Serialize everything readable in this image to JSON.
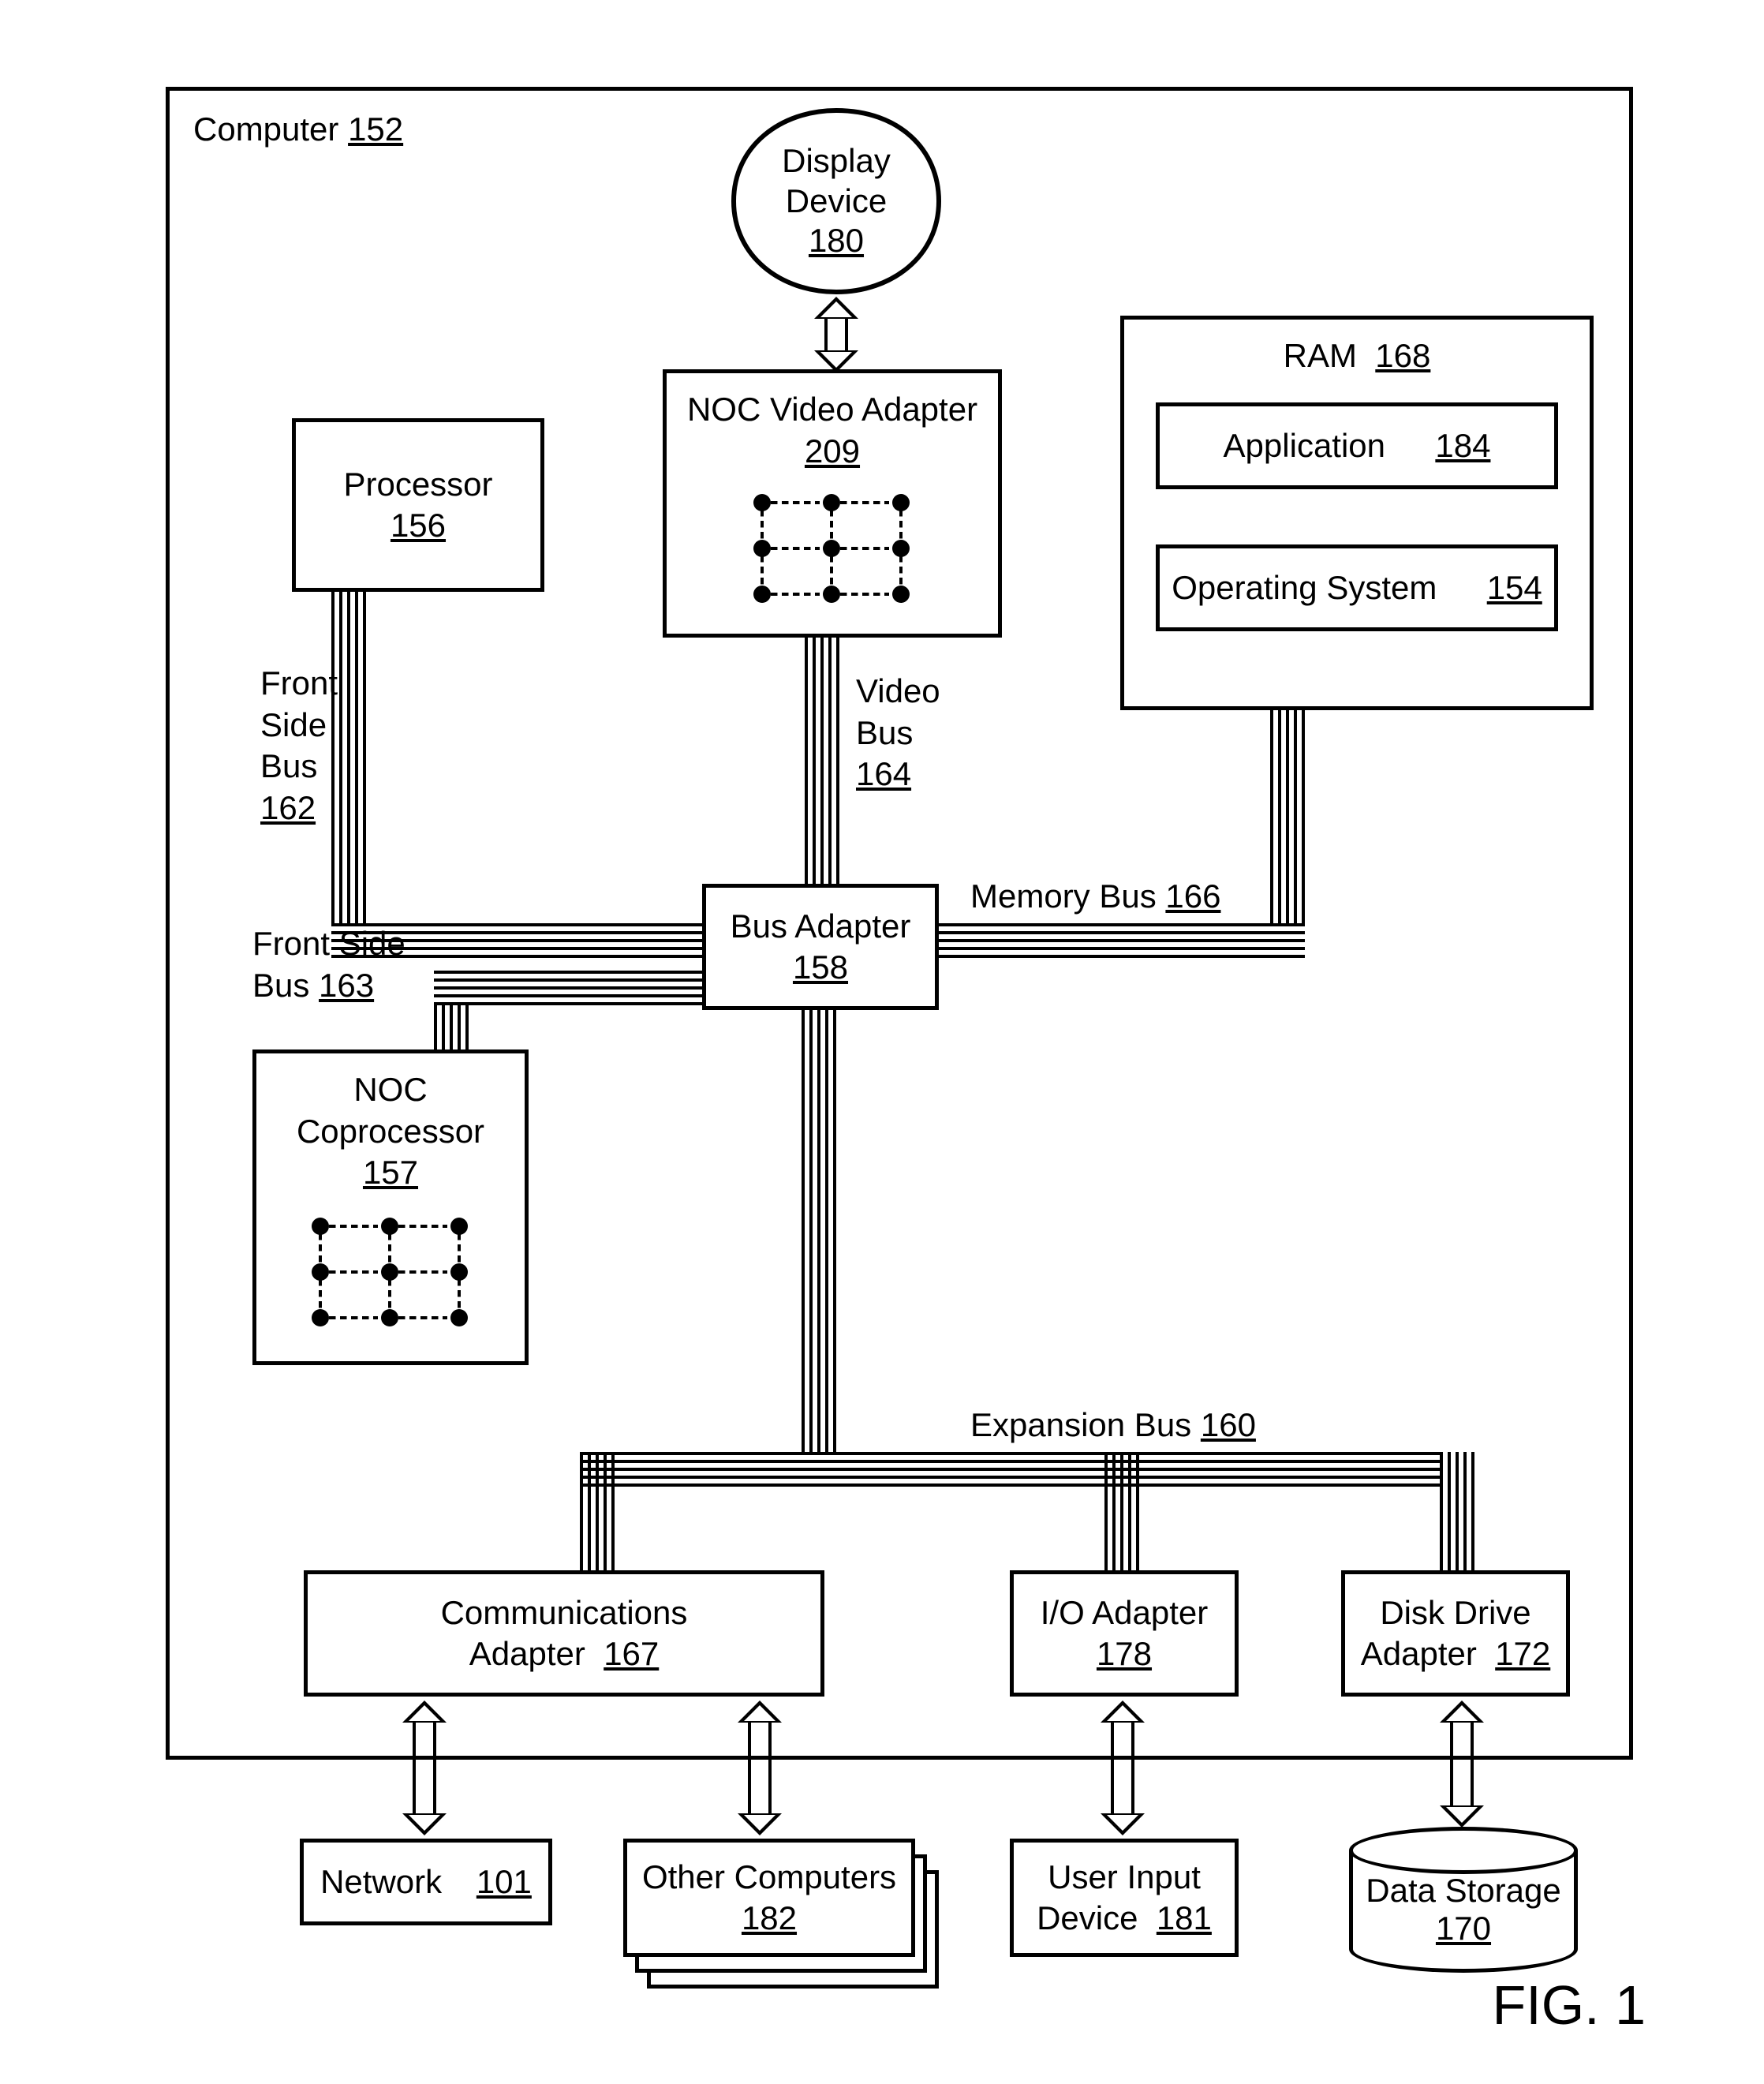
{
  "figure_label": "FIG. 1",
  "computer": {
    "label": "Computer",
    "ref": "152"
  },
  "display_device": {
    "label1": "Display",
    "label2": "Device",
    "ref": "180"
  },
  "noc_video_adapter": {
    "label": "NOC Video Adapter",
    "ref": "209"
  },
  "processor": {
    "label": "Processor",
    "ref": "156"
  },
  "ram": {
    "label": "RAM",
    "ref": "168"
  },
  "application": {
    "label": "Application",
    "ref": "184"
  },
  "operating_system": {
    "label": "Operating System",
    "ref": "154"
  },
  "bus_adapter": {
    "label": "Bus Adapter",
    "ref": "158"
  },
  "noc_coprocessor": {
    "label1": "NOC",
    "label2": "Coprocessor",
    "ref": "157"
  },
  "communications_adapter": {
    "label1": "Communications",
    "label2": "Adapter",
    "ref": "167"
  },
  "io_adapter": {
    "label": "I/O Adapter",
    "ref": "178"
  },
  "disk_drive_adapter": {
    "label1": "Disk Drive",
    "label2": "Adapter",
    "ref": "172"
  },
  "network": {
    "label": "Network",
    "ref": "101"
  },
  "other_computers": {
    "label": "Other Computers",
    "ref": "182"
  },
  "user_input_device": {
    "label1": "User Input",
    "label2": "Device",
    "ref": "181"
  },
  "data_storage": {
    "label": "Data Storage",
    "ref": "170"
  },
  "front_side_bus_162": {
    "l1": "Front",
    "l2": "Side",
    "l3": "Bus",
    "ref": "162"
  },
  "video_bus": {
    "l1": "Video",
    "l2": "Bus",
    "ref": "164"
  },
  "memory_bus": {
    "label": "Memory Bus",
    "ref": "166"
  },
  "front_side_bus_163": {
    "l1": "Front Side",
    "l2": "Bus",
    "ref": "163"
  },
  "expansion_bus": {
    "label": "Expansion Bus",
    "ref": "160"
  }
}
